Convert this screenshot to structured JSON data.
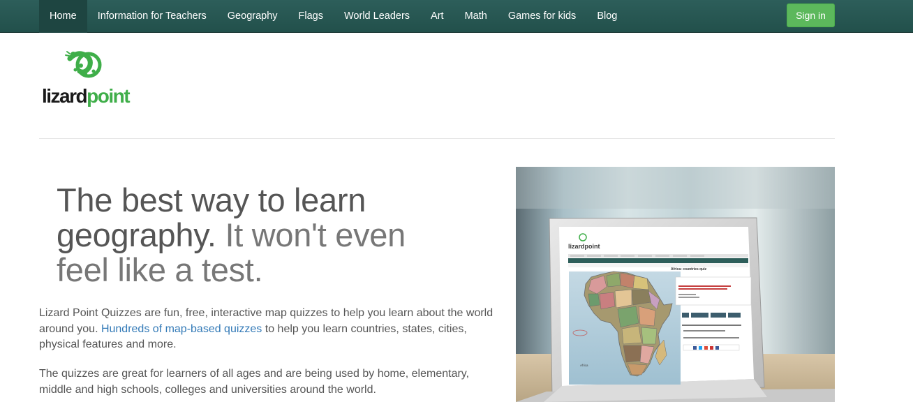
{
  "nav": {
    "items": [
      "Home",
      "Information for Teachers",
      "Geography",
      "Flags",
      "World Leaders",
      "Art",
      "Math",
      "Games for kids",
      "Blog"
    ],
    "signin_label": "Sign in"
  },
  "logo": {
    "part1": "lizard",
    "part2": "point"
  },
  "hero": {
    "headline_dark": "The best way to learn geography.",
    "headline_light": " It won't even feel like a test.",
    "para1_before": "Lizard Point Quizzes are fun, free, interactive map quizzes to help you learn about the world around you. ",
    "para1_link": "Hundreds of map-based quizzes",
    "para1_after": " to help you learn countries, states, cities, physical features and more.",
    "para2": "The quizzes are great for learners of all ages and are being used by home, elementary, middle and high schools, colleges and universities around the world."
  },
  "screen": {
    "logo_text": "lizardpoint",
    "quiz_title": "Africa: countries quiz",
    "map_label": "Africa"
  },
  "colors": {
    "nav_bg": "#2d5e5a",
    "signin_bg": "#5cb85c",
    "link": "#337ab7",
    "logo_green": "#3fae49"
  }
}
